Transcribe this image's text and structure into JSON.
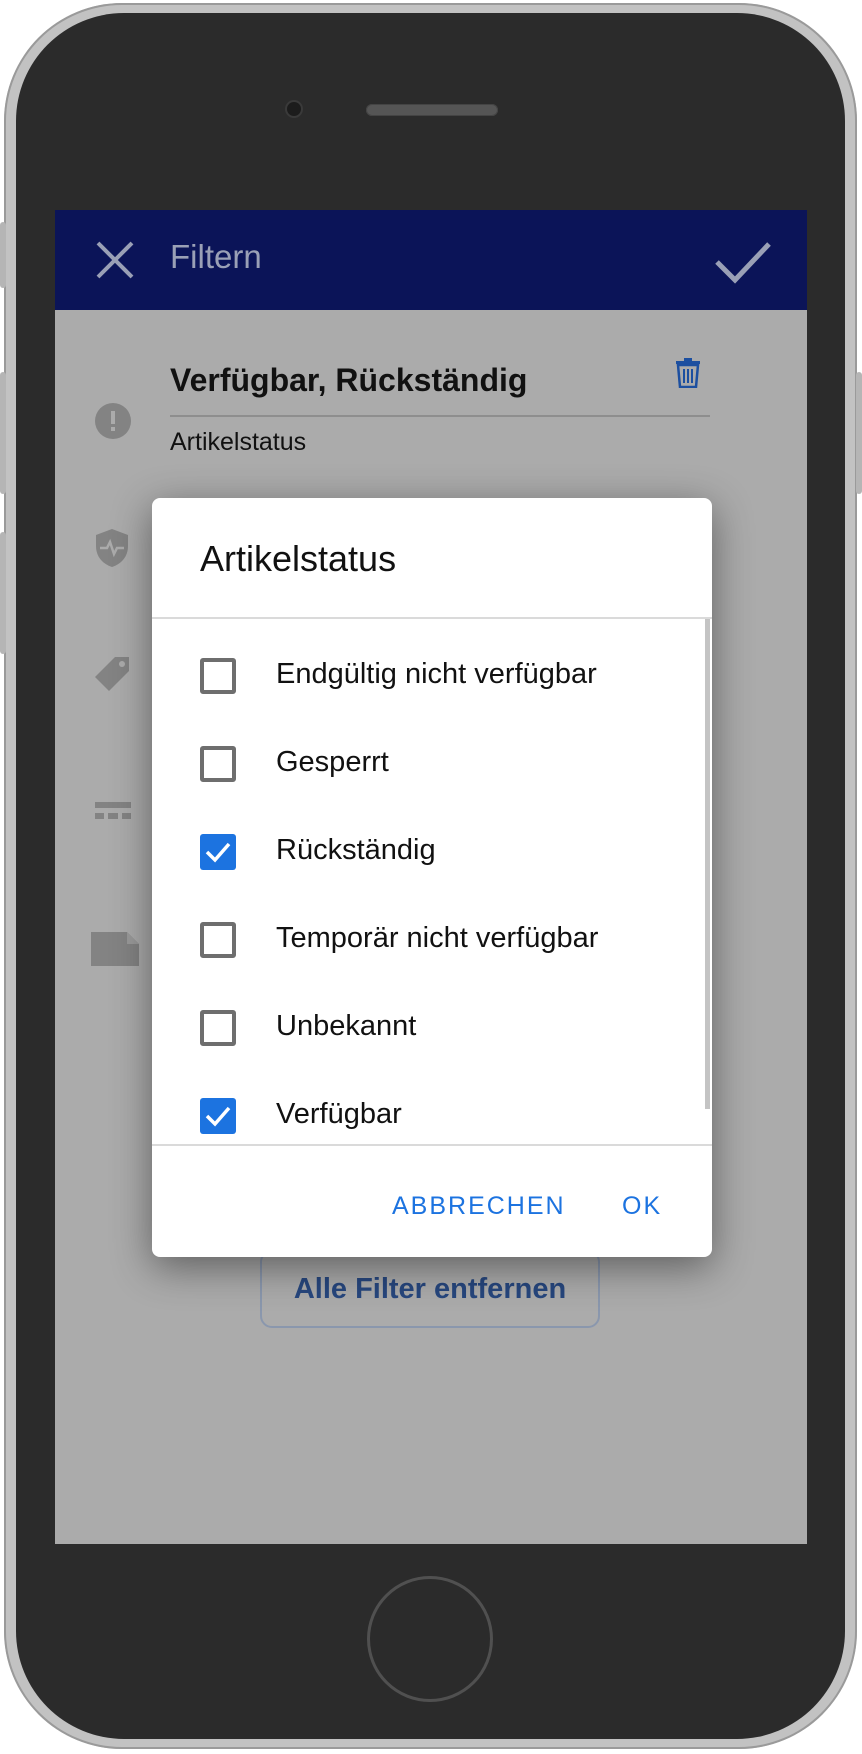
{
  "appbar": {
    "title": "Filtern"
  },
  "filter_row": {
    "value": "Verfügbar, Rückständig",
    "label": "Artikelstatus"
  },
  "remove_all_label": "Alle Filter entfernen",
  "dialog": {
    "title": "Artikelstatus",
    "options": [
      {
        "label": "Endgültig nicht verfügbar",
        "checked": false
      },
      {
        "label": "Gesperrt",
        "checked": false
      },
      {
        "label": "Rückständig",
        "checked": true
      },
      {
        "label": "Temporär nicht verfügbar",
        "checked": false
      },
      {
        "label": "Unbekannt",
        "checked": false
      },
      {
        "label": "Verfügbar",
        "checked": true
      }
    ],
    "cancel_label": "ABBRECHEN",
    "ok_label": "OK"
  },
  "icons": {
    "close": "close-icon",
    "confirm": "check-icon",
    "delete": "trash-icon",
    "status": "alert-circle-icon",
    "health": "shield-pulse-icon",
    "tag": "tag-icon",
    "category": "segments-icon",
    "document": "document-icon"
  },
  "colors": {
    "appbar": "#0b1458",
    "accent": "#1c73e0",
    "scrim": "#ababab"
  }
}
